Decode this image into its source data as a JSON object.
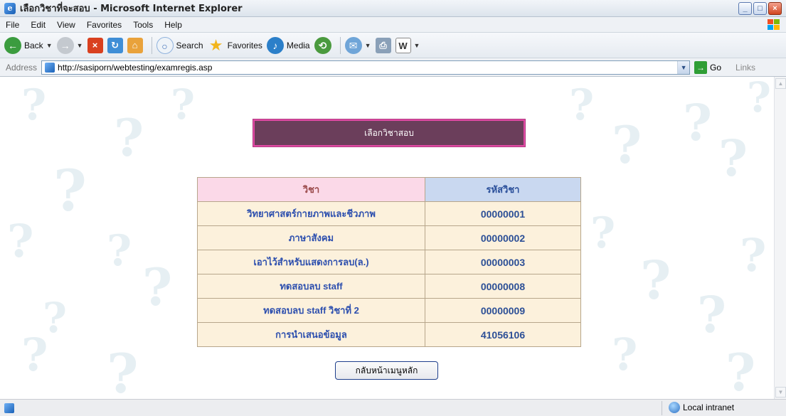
{
  "window": {
    "title": "เลือกวิชาที่จะสอบ - Microsoft Internet Explorer",
    "controls": [
      "_",
      "□",
      "×"
    ]
  },
  "menu": [
    "File",
    "Edit",
    "View",
    "Favorites",
    "Tools",
    "Help"
  ],
  "toolbar": {
    "back": "Back",
    "search": "Search",
    "favorites": "Favorites",
    "media": "Media"
  },
  "address": {
    "label": "Address",
    "url": "http://sasiporn/webtesting/examregis.asp",
    "go": "Go",
    "links": "Links"
  },
  "page": {
    "heading": "เลือกวิชาสอบ",
    "table": {
      "headers": [
        "วิชา",
        "รหัสวิชา"
      ],
      "rows": [
        [
          "วิทยาศาสตร์กายภาพและชีวภาพ",
          "00000001"
        ],
        [
          "ภาษาสังคม",
          "00000002"
        ],
        [
          "เอาไว้สำหรับแสดงการลบ(ล.)",
          "00000003"
        ],
        [
          "ทดสอบลบ staff",
          "00000008"
        ],
        [
          "ทดสอบลบ staff วิชาที่ 2",
          "00000009"
        ],
        [
          "การนำเสนอข้อมูล",
          "41056106"
        ]
      ]
    },
    "home_button": "กลับหน้าเมนูหลัก"
  },
  "status": {
    "zone": "Local intranet"
  },
  "colors": {
    "heading_bg": "#6b3e5b",
    "heading_border": "#e04aa4",
    "subject_header_bg": "#fbd9e8",
    "code_header_bg": "#c9d8f0",
    "row_bg": "#fcf1dc",
    "link_text": "#2d4fae"
  }
}
